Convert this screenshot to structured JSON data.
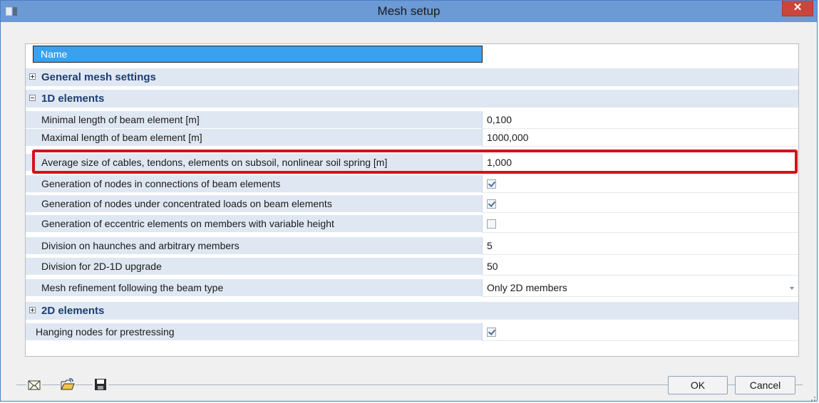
{
  "window": {
    "title": "Mesh setup",
    "close_glyph": "✕"
  },
  "grid": {
    "header_label": "Name",
    "categories": {
      "general": "General mesh settings",
      "one_d": "1D elements",
      "two_d": "2D elements"
    },
    "rows": [
      {
        "label": "Minimal length of beam element [m]",
        "value": "0,100"
      },
      {
        "label": "Maximal length of beam element [m]",
        "value": "1000,000"
      },
      {
        "label": "Average size of cables, tendons, elements on subsoil, nonlinear soil spring [m]",
        "value": "1,000"
      },
      {
        "label": "Generation of nodes in connections of beam elements",
        "checked": true
      },
      {
        "label": "Generation of nodes under concentrated loads on beam elements",
        "checked": true
      },
      {
        "label": "Generation of eccentric elements on members with variable height",
        "checked": false
      },
      {
        "label": "Division on haunches and arbitrary members",
        "value": "5"
      },
      {
        "label": "Division for 2D-1D upgrade",
        "value": "50"
      },
      {
        "label": "Mesh refinement following the beam type",
        "value": "Only 2D members"
      }
    ],
    "hanging": {
      "label": "Hanging nodes for prestressing",
      "checked": true
    }
  },
  "buttons": {
    "ok": "OK",
    "cancel": "Cancel"
  },
  "icons": [
    "mail-icon",
    "open-folder-icon",
    "save-icon"
  ],
  "colors": {
    "titlebar": "#6b9ad4",
    "highlight": "#d4121b",
    "header_selected": "#39a1ee"
  }
}
